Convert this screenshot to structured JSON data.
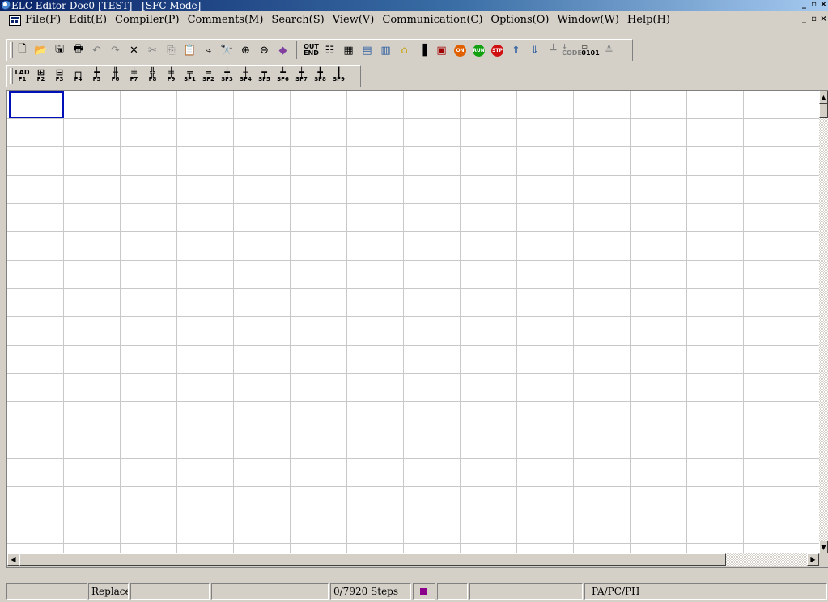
{
  "window": {
    "title": "ELC Editor-Doc0-[TEST] - [SFC Mode]",
    "controls": [
      "_",
      "▫",
      "×"
    ]
  },
  "menu": {
    "items": [
      "File(F)",
      "Edit(E)",
      "Compiler(P)",
      "Comments(M)",
      "Search(S)",
      "View(V)",
      "Communication(C)",
      "Options(O)",
      "Window(W)",
      "Help(H)"
    ]
  },
  "toolbar2": {
    "buttons": [
      {
        "top": "LAD",
        "bottom": "F1"
      },
      {
        "top": "⊞",
        "bottom": "F2"
      },
      {
        "top": "⊟",
        "bottom": "F3"
      },
      {
        "top": "┌┐",
        "bottom": "F4"
      },
      {
        "top": "┿",
        "bottom": "F5"
      },
      {
        "top": "╫",
        "bottom": "F6"
      },
      {
        "top": "╪",
        "bottom": "F7"
      },
      {
        "top": "╬",
        "bottom": "F8"
      },
      {
        "top": "╪",
        "bottom": "F9"
      },
      {
        "top": "╤",
        "bottom": "SF1"
      },
      {
        "top": "═",
        "bottom": "SF2"
      },
      {
        "top": "┿",
        "bottom": "SF3"
      },
      {
        "top": "┼",
        "bottom": "SF4"
      },
      {
        "top": "┯",
        "bottom": "SF5"
      },
      {
        "top": "┷",
        "bottom": "SF6"
      },
      {
        "top": "┿",
        "bottom": "SF7"
      },
      {
        "top": "╋",
        "bottom": "SF8"
      },
      {
        "top": "┃",
        "bottom": "SF9"
      }
    ]
  },
  "statusbar": {
    "mode": "Replace",
    "steps": "0/7920 Steps",
    "plc_type": "PA/PC/PH"
  },
  "colors": {
    "title_start": "#0a246a",
    "title_end": "#a6caf0",
    "cursor": "#0010b8",
    "status_indicator": "#8b008b"
  }
}
